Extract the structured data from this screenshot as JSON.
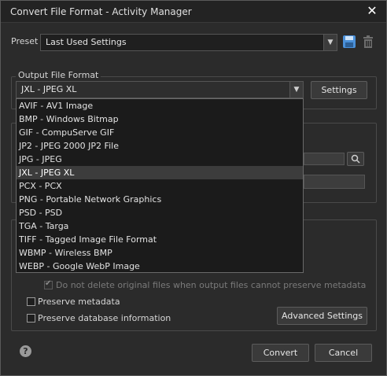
{
  "window": {
    "title": "Convert File Format - Activity Manager"
  },
  "preset": {
    "label": "Preset",
    "selected": "Last Used Settings"
  },
  "output": {
    "group_title": "Output File Format",
    "selected": "JXL - JPEG XL",
    "settings_label": "Settings",
    "options": [
      "AVIF - AV1 Image",
      "BMP - Windows Bitmap",
      "GIF - CompuServe GIF",
      "JP2 - JPEG 2000 JP2 File",
      "JPG - JPEG",
      "JXL - JPEG XL",
      "PCX - PCX",
      "PNG - Portable Network Graphics",
      "PSD - PSD",
      "TGA - Targa",
      "TIFF - Tagged Image File Format",
      "WBMP - Wireless BMP",
      "WEBP - Google WebP Image"
    ],
    "selected_index": 5
  },
  "options": {
    "no_delete_label": "Do not delete original files when output files cannot preserve metadata",
    "preserve_metadata_label": "Preserve metadata",
    "preserve_db_label": "Preserve database information",
    "advanced_label": "Advanced Settings"
  },
  "footer": {
    "convert_label": "Convert",
    "cancel_label": "Cancel",
    "help_glyph": "?"
  },
  "icons": {
    "close": "close-icon",
    "save": "save-icon",
    "delete": "trash-icon",
    "dropdown": "chevron-down-icon",
    "browse": "search-icon",
    "help": "help-icon"
  },
  "colors": {
    "background": "#2b2b2b",
    "titlebar": "#232323",
    "selection": "#3c3c3c",
    "save_icon": "#4a90d9"
  }
}
